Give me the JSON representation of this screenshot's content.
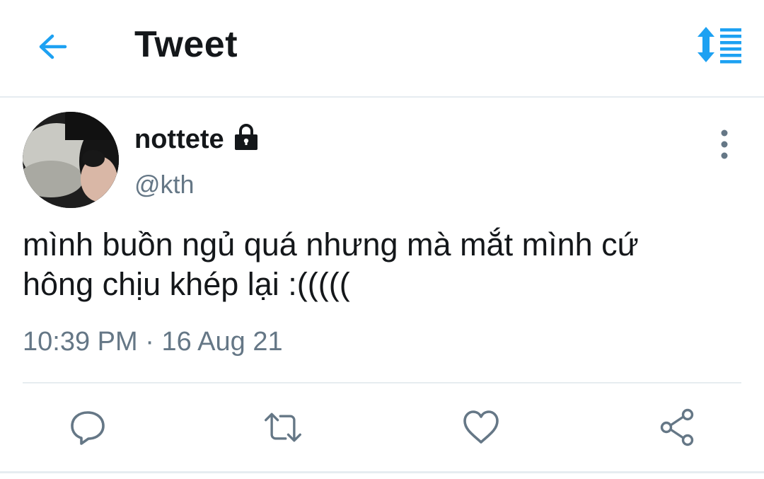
{
  "header": {
    "title": "Tweet",
    "back_icon": "arrow-left-icon",
    "sort_icon": "sort-lines-icon"
  },
  "tweet": {
    "display_name": "nottete",
    "locked_icon": "lock-icon",
    "handle": "@kth",
    "text_line1": "mình buồn ngủ quá nhưng mà mắt mình cứ",
    "text_line2": "hông chịu khép lại :(((((",
    "time": "10:39 PM",
    "separator": "·",
    "date": "16 Aug 21"
  },
  "actions": [
    "reply-icon",
    "retweet-icon",
    "like-icon",
    "share-icon"
  ],
  "colors": {
    "accent": "#1da1f2",
    "muted": "#657786",
    "text": "#14171a",
    "border": "#e6ecf0"
  }
}
